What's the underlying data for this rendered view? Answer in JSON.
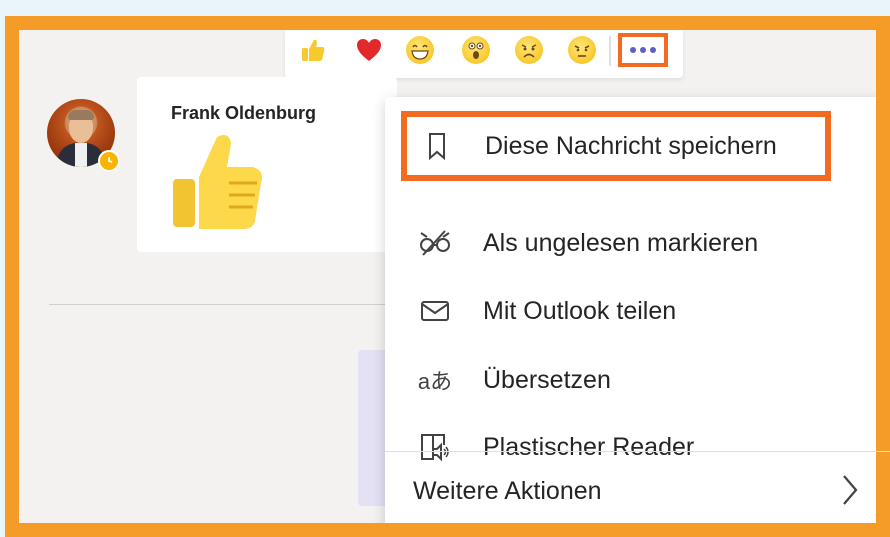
{
  "reactions": [
    {
      "name": "like",
      "icon": "thumbs-up-icon"
    },
    {
      "name": "heart",
      "icon": "heart-icon"
    },
    {
      "name": "laugh",
      "icon": "laughing-face-icon"
    },
    {
      "name": "surprised",
      "icon": "surprised-face-icon"
    },
    {
      "name": "sad",
      "icon": "sad-face-icon"
    },
    {
      "name": "angry",
      "icon": "angry-face-icon"
    }
  ],
  "more_options_icon": "more-options-icon",
  "message": {
    "sender": "Frank Oldenburg",
    "content_icon": "thumbs-up-emoji-icon",
    "status_icon": "clock-icon"
  },
  "context_menu": {
    "items": [
      {
        "label": "Diese Nachricht speichern",
        "icon": "bookmark-icon"
      },
      {
        "label": "Als ungelesen markieren",
        "icon": "unread-glasses-icon"
      },
      {
        "label": "Mit Outlook teilen",
        "icon": "mail-icon"
      },
      {
        "label": "Übersetzen",
        "icon": "translate-icon",
        "icon_text": "aあ"
      },
      {
        "label": "Plastischer Reader",
        "icon": "immersive-reader-icon"
      }
    ],
    "more_actions": {
      "label": "Weitere Aktionen",
      "icon": "chevron-right-icon"
    }
  },
  "colors": {
    "highlight": "#f26b21",
    "frame": "#f59b27",
    "accent": "#5b5fc7",
    "background": "#f3f2f1"
  }
}
